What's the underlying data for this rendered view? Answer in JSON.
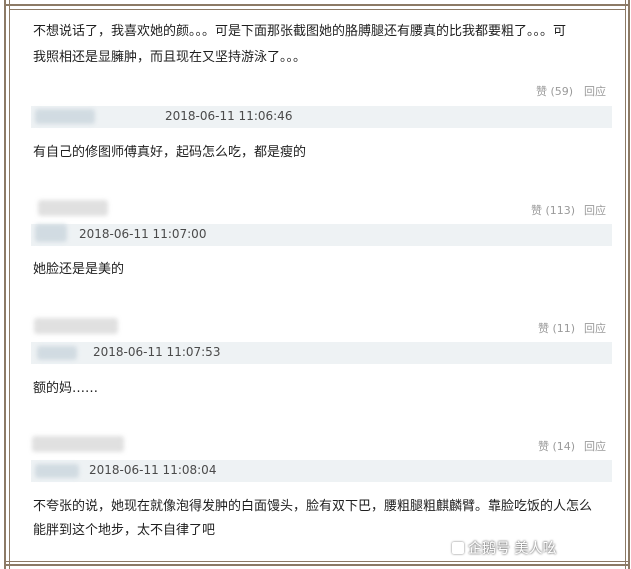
{
  "comments": [
    {
      "text_lines": [
        "不想说话了，我喜欢她的颜。。。可是下面那张截图她的胳膊腿还有腰真的比我都要粗了。。。可",
        "我照相还是显臃肿，而且现在又坚持游泳了。。。"
      ],
      "likes": "赞 (59)",
      "reply": "回应"
    },
    {
      "timestamp": "2018-06-11 11:06:46",
      "text_lines": [
        "有自己的修图师傅真好，起码怎么吃，都是瘦的"
      ],
      "likes": "赞 (113)",
      "reply": "回应"
    },
    {
      "timestamp": "2018-06-11 11:07:00",
      "text_lines": [
        "她脸还是是美的"
      ],
      "likes": "赞 (11)",
      "reply": "回应"
    },
    {
      "timestamp": "2018-06-11 11:07:53",
      "text_lines": [
        "额的妈……"
      ],
      "likes": "赞 (14)",
      "reply": "回应"
    },
    {
      "timestamp": "2018-06-11 11:08:04",
      "text_lines": [
        "不夸张的说，她现在就像泡得发肿的白面馒头，脸有双下巴，腰粗腿粗麒麟臂。靠脸吃饭的人怎么",
        "能胖到这个地步，太不自律了吧"
      ]
    }
  ],
  "watermark": "企鹅号 美人吆",
  "colors": {
    "frame": "#8c7a66",
    "meta_bar": "#eef2f4",
    "action_text": "#9a9a9a"
  }
}
